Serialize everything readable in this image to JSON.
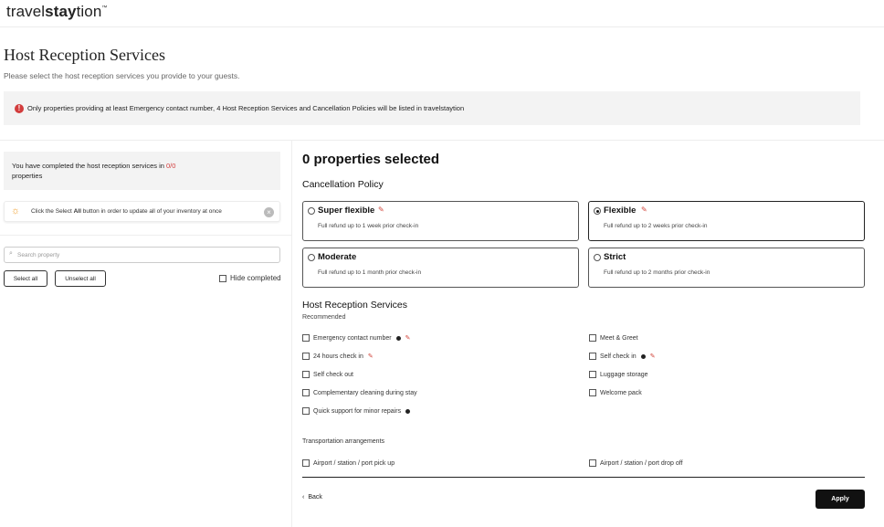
{
  "brand": {
    "logo_part1": "travel",
    "logo_part2": "stay",
    "logo_part3": "tion",
    "logo_tm": "™"
  },
  "header": {
    "title": "Host Reception Services",
    "subtitle": "Please select the host reception services you provide to your guests."
  },
  "notice": {
    "icon": "exclamation-icon",
    "text": "Only properties providing at least Emergency contact number, 4 Host Reception Services and Cancellation Policies will be listed in travelstaytion"
  },
  "sidebar": {
    "completed_prefix": "You have completed the host reception services in ",
    "completed_count": "0/0",
    "completed_suffix": "properties",
    "tip_text_1": "Click the Select ",
    "tip_text_bold": "All",
    "tip_text_2": " button in order to update all of your inventory at once",
    "search_placeholder": "Search property",
    "select_all": "Select all",
    "unselect_all": "Unselect all",
    "hide_completed": "Hide completed"
  },
  "main": {
    "properties_selected": "0 properties selected",
    "cancellation_title": "Cancellation Policy",
    "policies": [
      {
        "name": "Super flexible",
        "desc": "Full refund up to 1 week prior check-in",
        "selected": false
      },
      {
        "name": "Flexible",
        "desc": "Full refund up to 2 weeks prior check-in",
        "selected": true
      },
      {
        "name": "Moderate",
        "desc": "Full refund up to 1 month prior check-in",
        "selected": false
      },
      {
        "name": "Strict",
        "desc": "Full refund up to 2 months prior check-in",
        "selected": false
      }
    ],
    "hrs_title": "Host Reception Services",
    "recommended": "Recommended",
    "services": [
      "Emergency contact number",
      "24 hours check in",
      "Self check out",
      "Complementary cleaning during stay",
      "Quick support for minor repairs",
      "Meet & Greet",
      "Self check in",
      "Luggage storage",
      "Welcome pack"
    ],
    "transport_title": "Transportation arrangements",
    "transport": [
      "Airport / station / port pick up",
      "Airport / station / port drop off"
    ],
    "back": "Back",
    "apply": "Apply"
  }
}
